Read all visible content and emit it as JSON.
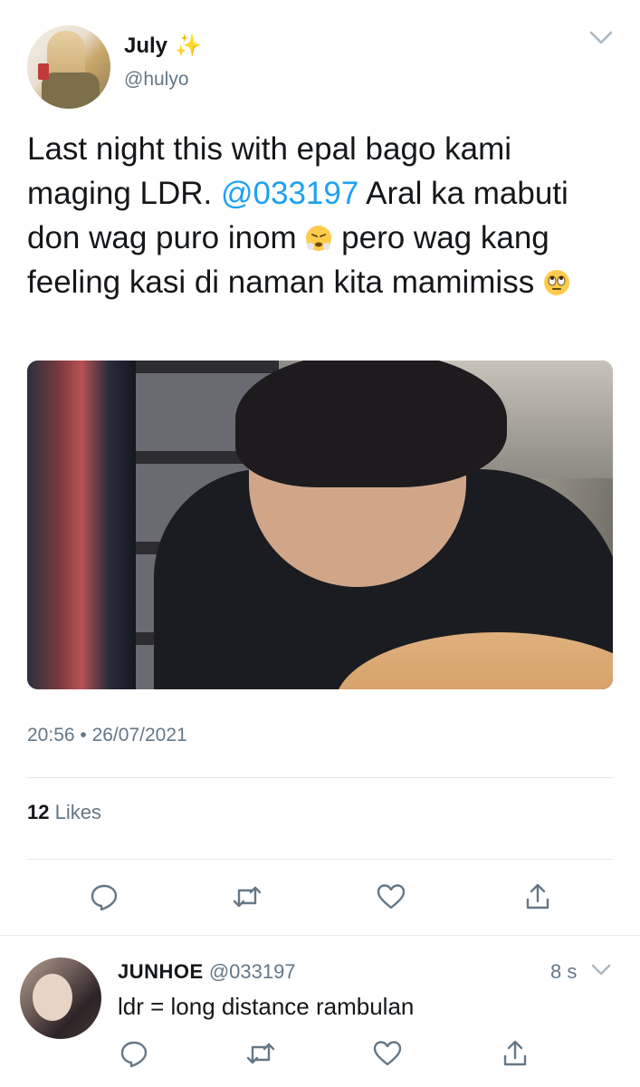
{
  "author": {
    "name": "July",
    "name_emoji": "✨",
    "handle": "@hulyo"
  },
  "tweet": {
    "text_part1": "Last night this with epal bago kami maging LDR. ",
    "mention": "@033197",
    "text_part2": " Aral ka mabuti don wag puro inom ",
    "text_part3": " pero wag kang feeling kasi di naman kita mamimiss ",
    "timestamp": "20:56 • 26/07/2021",
    "likes_count": "12",
    "likes_label": "Likes"
  },
  "reply": {
    "name": "JUNHOE",
    "handle": "@033197",
    "time": "8 s",
    "text": "ldr = long distance rambulan"
  },
  "colors": {
    "accent": "#1da1f2",
    "text": "#14171a",
    "secondary": "#657786",
    "divider": "#e1e8ed"
  },
  "icons": {
    "reply": "reply-icon",
    "retweet": "retweet-icon",
    "like": "like-icon",
    "share": "share-icon"
  }
}
